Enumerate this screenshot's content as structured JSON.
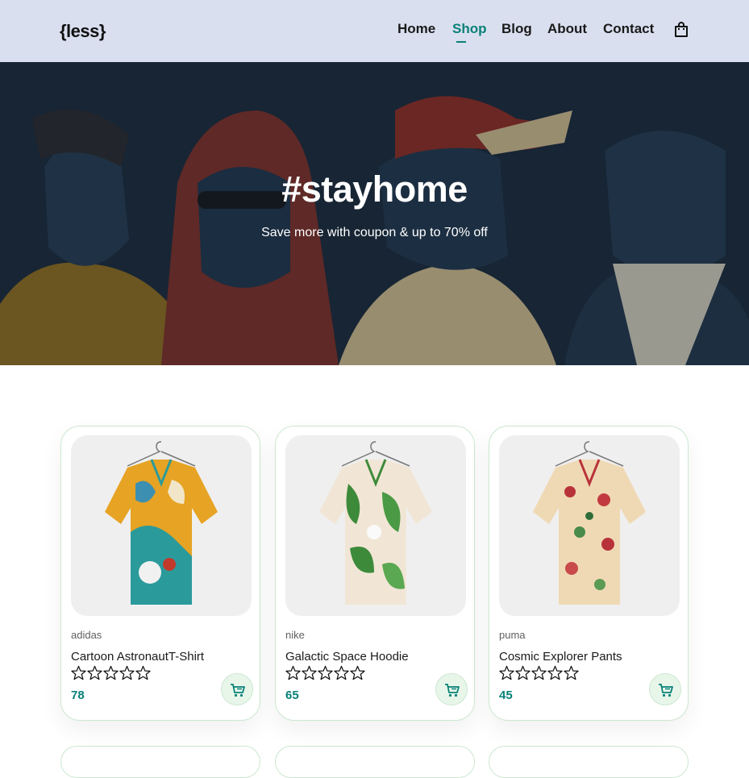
{
  "header": {
    "logo": "{less}",
    "nav": [
      {
        "label": "Home",
        "active": false
      },
      {
        "label": "Shop",
        "active": true
      },
      {
        "label": "Blog",
        "active": false
      },
      {
        "label": "About",
        "active": false
      },
      {
        "label": "Contact",
        "active": false
      }
    ],
    "cart_icon": "shopping-bag-icon"
  },
  "hero": {
    "title": "#stayhome",
    "subtitle": "Save more with coupon & up to 70% off"
  },
  "products": [
    {
      "brand": "adidas",
      "name": "Cartoon AstronautT-Shirt",
      "rating": 0,
      "max_rating": 5,
      "price": "78"
    },
    {
      "brand": "nike",
      "name": "Galactic Space Hoodie",
      "rating": 0,
      "max_rating": 5,
      "price": "65"
    },
    {
      "brand": "puma",
      "name": "Cosmic Explorer Pants",
      "rating": 0,
      "max_rating": 5,
      "price": "45"
    }
  ],
  "colors": {
    "accent": "#088178",
    "header_bg": "#dadff0",
    "card_border": "#cce7d0",
    "cart_button_bg": "#e8f6ea"
  }
}
